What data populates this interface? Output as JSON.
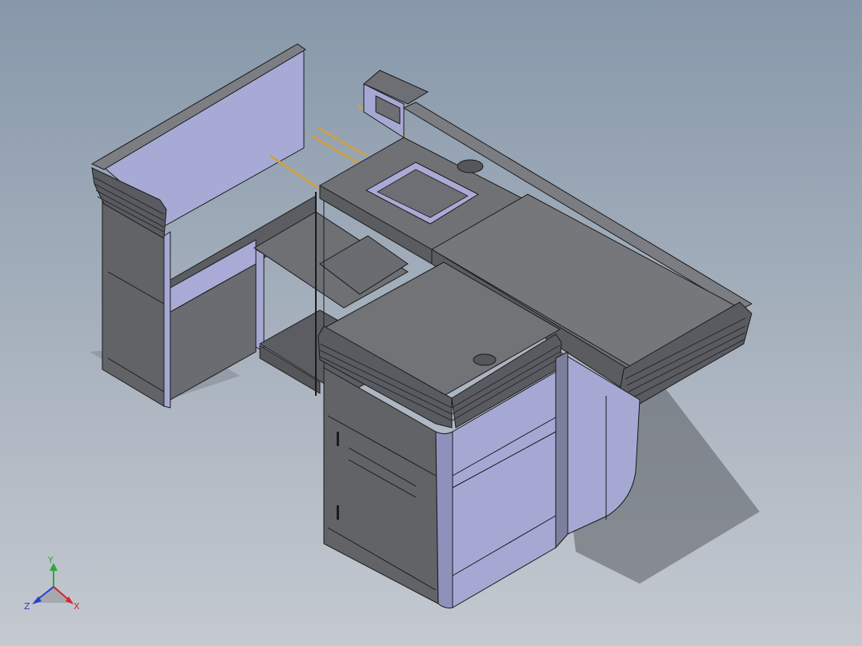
{
  "viewport": {
    "background_top": "#8798aa",
    "background_bottom": "#c4c9d0"
  },
  "model": {
    "face_top_color": "#6f7074",
    "face_front_color": "#5f6064",
    "face_side_color": "#a6a8d4",
    "edge_color": "#1a1a1a",
    "rod_color": "#c9a24a"
  },
  "triad": {
    "x_label": "X",
    "y_label": "Y",
    "z_label": "Z",
    "x_color": "#d8262a",
    "y_color": "#2fa83a",
    "z_color": "#2c3fc8"
  }
}
